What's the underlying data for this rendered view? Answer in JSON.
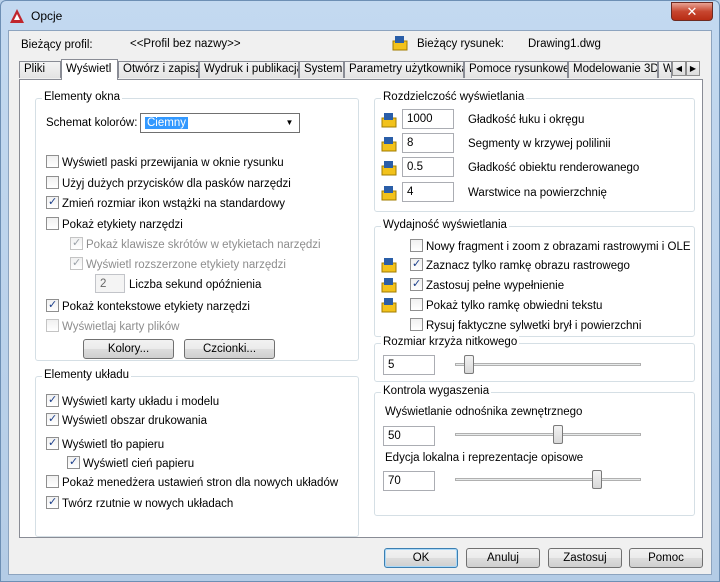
{
  "window": {
    "title": "Opcje",
    "close": "✕"
  },
  "header": {
    "profile_label": "Bieżący profil:",
    "profile_value": "<<Profil bez nazwy>>",
    "drawing_label": "Bieżący rysunek:",
    "drawing_value": "Drawing1.dwg"
  },
  "tabs": [
    "Pliki",
    "Wyświetl",
    "Otwórz i zapisz",
    "Wydruk i publikacja",
    "System",
    "Parametry użytkownika",
    "Pomoce rysunkowe",
    "Modelowanie 3D",
    "W"
  ],
  "active_tab": "Wyświetl",
  "window_elements": {
    "title": "Elementy okna",
    "scheme_label": "Schemat kolorów:",
    "scheme_value": "Ciemny",
    "items": [
      {
        "label": "Wyświetl paski przewijania w oknie rysunku",
        "checked": false,
        "enabled": true
      },
      {
        "label": "Użyj dużych przycisków dla pasków narzędzi",
        "checked": false,
        "enabled": true
      },
      {
        "label": "Zmień rozmiar ikon wstążki na standardowy",
        "checked": true,
        "enabled": true
      },
      {
        "label": "Pokaż etykiety narzędzi",
        "checked": false,
        "enabled": true
      },
      {
        "label": "Pokaż klawisze skrótów w etykietach narzędzi",
        "checked": true,
        "enabled": false
      },
      {
        "label": "Wyświetl rozszerzone etykiety narzędzi",
        "checked": true,
        "enabled": false
      },
      {
        "label": "Pokaż kontekstowe etykiety narzędzi",
        "checked": true,
        "enabled": true
      },
      {
        "label": "Wyświetlaj karty plików",
        "checked": false,
        "enabled": false
      }
    ],
    "delay_value": "2",
    "delay_label": "Liczba sekund opóźnienia",
    "colors_button": "Kolory...",
    "fonts_button": "Czcionki..."
  },
  "layout_elements": {
    "title": "Elementy układu",
    "items": [
      {
        "label": "Wyświetl karty układu i modelu",
        "checked": true
      },
      {
        "label": "Wyświetl obszar drukowania",
        "checked": true
      },
      {
        "label": "Wyświetl tło papieru",
        "checked": true
      },
      {
        "label": "Wyświetl cień papieru",
        "checked": true
      },
      {
        "label": "Pokaż menedżera ustawień stron dla nowych układów",
        "checked": false
      },
      {
        "label": "Twórz rzutnie w nowych układach",
        "checked": true
      }
    ]
  },
  "resolution": {
    "title": "Rozdzielczość wyświetlania",
    "items": [
      {
        "value": "1000",
        "label": "Gładkość łuku i okręgu"
      },
      {
        "value": "8",
        "label": "Segmenty w krzywej polilinii"
      },
      {
        "value": "0.5",
        "label": "Gładkość obiektu renderowanego"
      },
      {
        "value": "4",
        "label": "Warstwice na powierzchnię"
      }
    ]
  },
  "performance": {
    "title": "Wydajność wyświetlania",
    "items": [
      {
        "label": "Nowy fragment i zoom z obrazami rastrowymi i OLE",
        "checked": false,
        "icon": false
      },
      {
        "label": "Zaznacz tylko ramkę obrazu rastrowego",
        "checked": true,
        "icon": true
      },
      {
        "label": "Zastosuj pełne wypełnienie",
        "checked": true,
        "icon": true
      },
      {
        "label": "Pokaż tylko ramkę obwiedni tekstu",
        "checked": false,
        "icon": true
      },
      {
        "label": "Rysuj faktyczne sylwetki brył i powierzchni",
        "checked": false,
        "icon": false
      }
    ]
  },
  "crosshair": {
    "title": "Rozmiar krzyża nitkowego",
    "value": "5",
    "level": 5
  },
  "fade": {
    "title": "Kontrola wygaszenia",
    "xref_label": "Wyświetlanie odnośnika zewnętrznego",
    "xref_value": "50",
    "xref_level": 50,
    "edit_label": "Edycja lokalna i reprezentacje opisowe",
    "edit_value": "70",
    "edit_level": 70
  },
  "buttons": {
    "ok": "OK",
    "cancel": "Anuluj",
    "apply": "Zastosuj",
    "help": "Pomoc"
  },
  "colors": {
    "title_bar": "#b4cce6",
    "app_icon": "#c0262d",
    "accent": "#3399ff",
    "close": "#c7462f"
  }
}
